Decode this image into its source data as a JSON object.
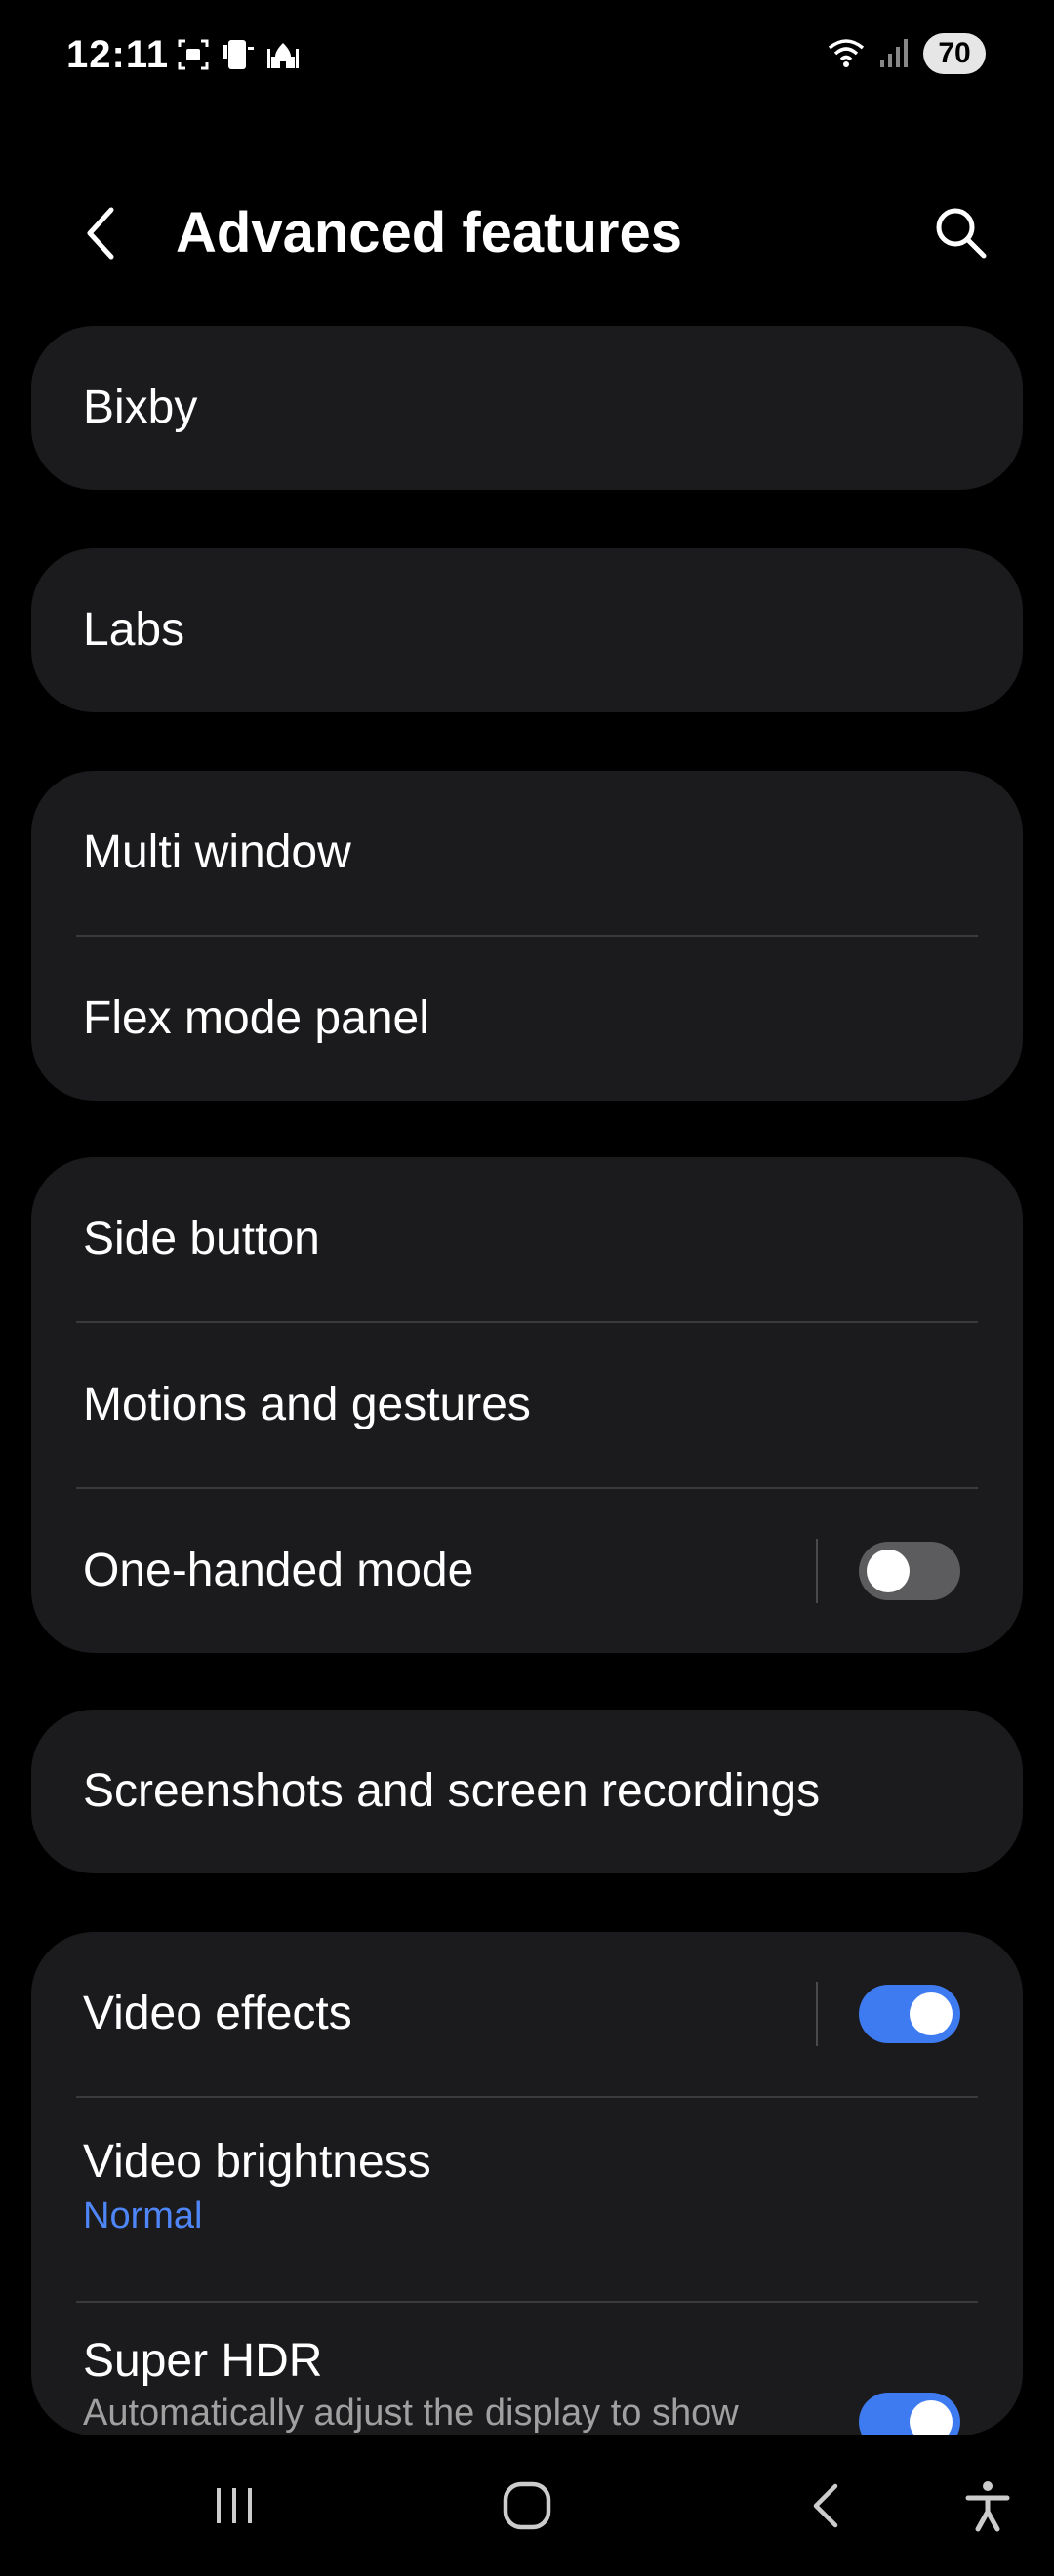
{
  "status_bar": {
    "time": "12:11",
    "battery": "70",
    "left_icons": [
      "screenshot-icon",
      "phone-icon",
      "mosque-icon"
    ],
    "right_icons": [
      "wifi-icon",
      "signal-icon"
    ]
  },
  "header": {
    "title": "Advanced features"
  },
  "items": {
    "bixby": "Bixby",
    "labs": "Labs",
    "multi_window": "Multi window",
    "flex_mode_panel": "Flex mode panel",
    "side_button": "Side button",
    "motions_gestures": "Motions and gestures",
    "one_handed_mode": "One-handed mode",
    "screenshots": "Screenshots and screen recordings",
    "video_effects": "Video effects",
    "video_brightness": "Video brightness",
    "video_brightness_value": "Normal",
    "super_hdr": "Super HDR",
    "super_hdr_desc": "Automatically adjust the display to show"
  },
  "toggles": {
    "one_handed_mode": false,
    "video_effects": true,
    "super_hdr": true
  },
  "colors": {
    "accent": "#3e7bf0",
    "link": "#4f86f7",
    "card_bg": "#1b1b1d"
  }
}
